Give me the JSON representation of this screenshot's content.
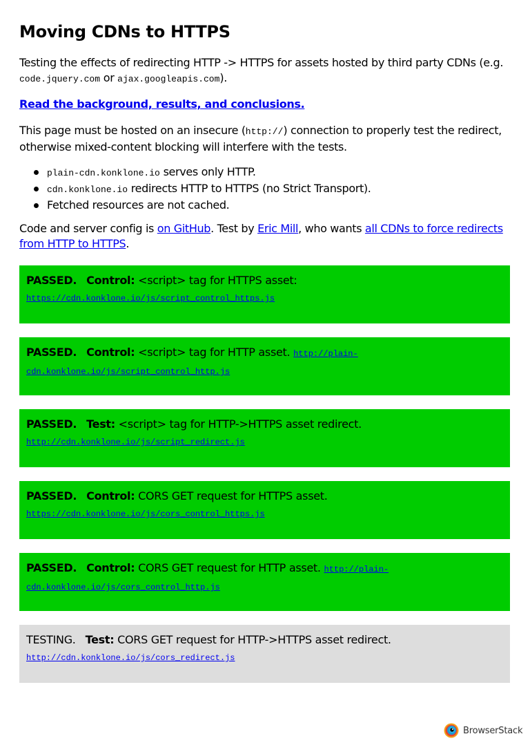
{
  "title": "Moving CDNs to HTTPS",
  "intro": {
    "text1": "Testing the effects of redirecting HTTP -> HTTPS for assets hosted by third party CDNs (e.g.",
    "code1": "code.jquery.com",
    "or": " or ",
    "code2": "ajax.googleapis.com",
    "end": ")."
  },
  "background_link": "Read the background, results, and conclusions.",
  "hosting_note": {
    "before": "This page must be hosted on an insecure (",
    "code": "http://",
    "after": ") connection to properly test the redirect, otherwise mixed-content blocking will interfere with the tests."
  },
  "bullets": [
    {
      "code": "plain-cdn.konklone.io",
      "text": " serves only HTTP."
    },
    {
      "code": "cdn.konklone.io",
      "text": " redirects HTTP to HTTPS (no Strict Transport)."
    },
    {
      "code": "",
      "text": "Fetched resources are not cached."
    }
  ],
  "credits": {
    "t1": "Code and server config is ",
    "link1": "on GitHub",
    "t2": ". Test by ",
    "link2": "Eric Mill",
    "t3": ", who wants ",
    "link3": "all CDNs to force redirects from HTTP to HTTPS",
    "t4": "."
  },
  "tests": [
    {
      "status": "PASSED.",
      "kind": "Control:",
      "desc": " <script> tag for HTTPS asset: ",
      "url": "https://cdn.konklone.io/js/script_control_https.js",
      "state": "pass"
    },
    {
      "status": "PASSED.",
      "kind": "Control:",
      "desc": " <script> tag for HTTP asset. ",
      "url": "http://plain-cdn.konklone.io/js/script_control_http.js",
      "state": "pass"
    },
    {
      "status": "PASSED.",
      "kind": "Test:",
      "desc": " <script> tag for HTTP->HTTPS asset redirect. ",
      "url": "http://cdn.konklone.io/js/script_redirect.js",
      "state": "pass"
    },
    {
      "status": "PASSED.",
      "kind": "Control:",
      "desc": " CORS GET request for HTTPS asset. ",
      "url": "https://cdn.konklone.io/js/cors_control_https.js",
      "state": "pass"
    },
    {
      "status": "PASSED.",
      "kind": "Control:",
      "desc": " CORS GET request for HTTP asset. ",
      "url": "http://plain-cdn.konklone.io/js/cors_control_http.js",
      "state": "pass"
    },
    {
      "status": "TESTING.",
      "kind": "Test:",
      "desc": " CORS GET request for HTTP->HTTPS asset redirect. ",
      "url": "http://cdn.konklone.io/js/cors_redirect.js",
      "state": "testing"
    }
  ],
  "colors": {
    "passed": "#00cc00",
    "testing": "#dddddd",
    "link": "#0000ee"
  },
  "watermark": {
    "text": "BrowserStack",
    "icon": "browserstack-logo-icon"
  }
}
